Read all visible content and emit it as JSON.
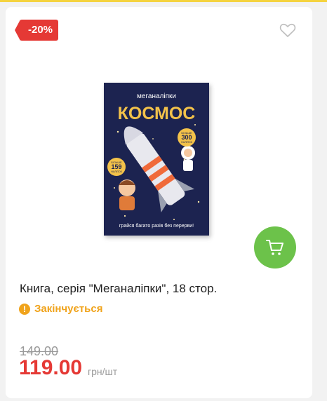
{
  "badge": {
    "discount": "-20%"
  },
  "product": {
    "title": "Книга, серія \"Меганаліпки\", 18 стор.",
    "cover": {
      "series": "меганаліпки",
      "heading": "КОСМОС",
      "badge_more": "БІЛЬШЕ",
      "badge_more_count": "300",
      "badge_more_unit": "НАЛІПОК",
      "badge_reusable": "БІЛЬШЕ",
      "badge_reusable_count": "159",
      "badge_reusable_unit": "НАЛІПОК",
      "footer": "грайся багато разів без перерви!"
    }
  },
  "status": {
    "text": "Закінчується",
    "icon": "alert-icon"
  },
  "price": {
    "old": "149.00",
    "current": "119.00",
    "unit": "грн/шт"
  },
  "colors": {
    "accent_red": "#e53935",
    "cart_green": "#6cc24a",
    "warning_orange": "#f0a31b",
    "cover_navy": "#1c2350"
  }
}
